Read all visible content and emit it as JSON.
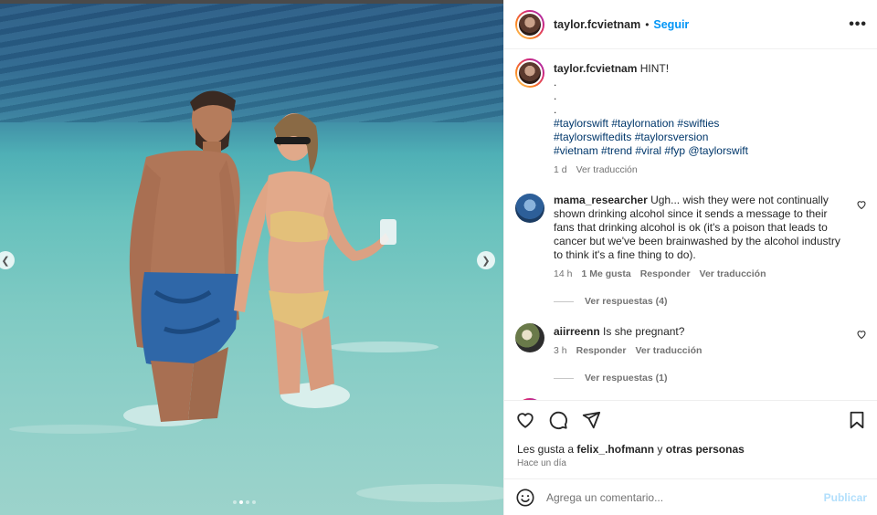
{
  "header": {
    "username": "taylor.fcvietnam",
    "separator": "•",
    "follow_label": "Seguir",
    "more_icon": "more-horizontal-icon"
  },
  "caption": {
    "username": "taylor.fcvietnam",
    "text": "HINT!",
    "dots": [
      ".",
      ".",
      "."
    ],
    "hashtags": [
      "#taylorswift #taylornation #swifties",
      "#taylorswiftedits #taylorsversion",
      "#vietnam #trend #viral #fyp @taylorswift"
    ],
    "time": "1 d",
    "translate_label": "Ver traducción"
  },
  "comments": [
    {
      "username": "mama_researcher",
      "text": "Ugh... wish they were not continually shown drinking alcohol since it sends a message to their fans that drinking alcohol is ok (it's a poison that leads to cancer but we've been brainwashed by the alcohol industry to think it's a fine thing to do).",
      "time": "14 h",
      "likes": "1 Me gusta",
      "reply_label": "Responder",
      "translate_label": "Ver traducción",
      "replies_label": "Ver respuestas (4)"
    },
    {
      "username": "aiirreenn",
      "text": "Is she pregnant?",
      "time": "3 h",
      "reply_label": "Responder",
      "translate_label": "Ver traducción",
      "replies_label": "Ver respuestas (1)"
    }
  ],
  "actions": {
    "like_icon": "heart-icon",
    "comment_icon": "comment-icon",
    "share_icon": "send-icon",
    "save_icon": "bookmark-icon"
  },
  "likes": {
    "prefix": "Les gusta a",
    "user": "felix_.hofmann",
    "joiner": "y",
    "others": "otras personas"
  },
  "posted": "Hace un día",
  "add_comment": {
    "placeholder": "Agrega un comentario...",
    "publish_label": "Publicar",
    "emoji_icon": "emoji-icon"
  },
  "carousel": {
    "count": 4,
    "active_index": 1
  },
  "colors": {
    "link_blue": "#0095f6",
    "hashtag_blue": "#00376b",
    "publish_disabled": "#b2dffc",
    "muted": "#737373"
  }
}
